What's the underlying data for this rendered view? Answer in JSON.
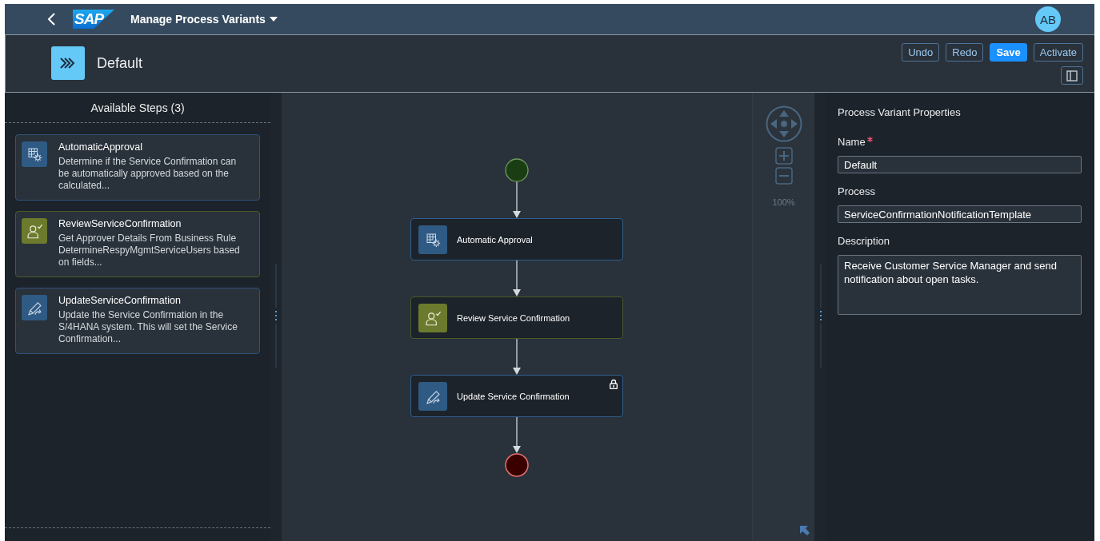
{
  "shell": {
    "logo": "SAP",
    "title": "Manage Process Variants",
    "avatar": "AB"
  },
  "header": {
    "title": "Default",
    "actions": [
      {
        "label": "Undo",
        "emphasized": false
      },
      {
        "label": "Redo",
        "emphasized": false
      },
      {
        "label": "Save",
        "emphasized": true
      },
      {
        "label": "Activate",
        "emphasized": false
      }
    ]
  },
  "steps_panel": {
    "title": "Available Steps (3)",
    "steps": [
      {
        "kind": "rule",
        "name": "AutomaticApproval",
        "description": "Determine if the Service Confirmation can be automatically approved based on the calculated..."
      },
      {
        "kind": "approval",
        "name": "ReviewServiceConfirmation",
        "description": "Get Approver Details From Business Rule DetermineRespyMgmtServiceUsers based on fields..."
      },
      {
        "kind": "update",
        "name": "UpdateServiceConfirmation",
        "description": "Update the Service Confirmation in the S/4HANA system. This will set the Service Confirmation..."
      }
    ]
  },
  "flow": {
    "nodes": [
      {
        "kind": "rule",
        "label": "Automatic Approval",
        "locked": false
      },
      {
        "kind": "approval",
        "label": "Review Service Confirmation",
        "locked": false
      },
      {
        "kind": "update",
        "label": "Update Service Confirmation",
        "locked": true
      }
    ]
  },
  "zoom": {
    "reading": "100%"
  },
  "properties": {
    "title": "Process Variant Properties",
    "fields": [
      {
        "kind": "input",
        "label": "Name",
        "required": true,
        "value": "Default"
      },
      {
        "kind": "input",
        "label": "Process",
        "required": false,
        "value": "ServiceConfirmationNotificationTemplate"
      },
      {
        "kind": "textarea",
        "label": "Description",
        "required": false,
        "value": "Receive Customer Service Manager and send notification about open tasks."
      }
    ]
  }
}
